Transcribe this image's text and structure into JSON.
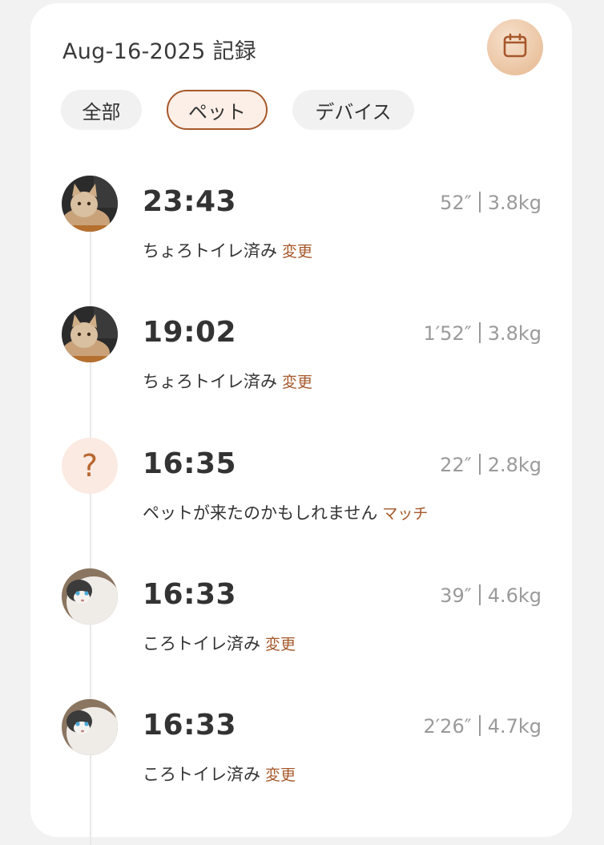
{
  "header": {
    "title": "Aug-16-2025 記録",
    "calendar_icon": "calendar-icon"
  },
  "tabs": [
    {
      "label": "全部",
      "selected": false
    },
    {
      "label": "ペット",
      "selected": true
    },
    {
      "label": "デバイス",
      "selected": false
    }
  ],
  "colors": {
    "accent": "#a6582b",
    "selected_tab_bg": "#fcefe7",
    "unknown_avatar_bg": "#fbeae2"
  },
  "entries": [
    {
      "avatar": "cat-tan-photo",
      "time": "23:43",
      "duration": "52″",
      "weight": "3.8kg",
      "status": "ちょろトイレ済み",
      "action": "変更"
    },
    {
      "avatar": "cat-tan-photo",
      "time": "19:02",
      "duration": "1′52″",
      "weight": "3.8kg",
      "status": "ちょろトイレ済み",
      "action": "変更"
    },
    {
      "avatar": "question-mark-icon",
      "avatar_text": "?",
      "time": "16:35",
      "duration": "22″",
      "weight": "2.8kg",
      "status": "ペットが来たのかもしれません",
      "action": "マッチ"
    },
    {
      "avatar": "cat-white-photo",
      "time": "16:33",
      "duration": "39″",
      "weight": "4.6kg",
      "status": "ころトイレ済み",
      "action": "変更"
    },
    {
      "avatar": "cat-white-photo",
      "time": "16:33",
      "duration": "2′26″",
      "weight": "4.7kg",
      "status": "ころトイレ済み",
      "action": "変更"
    }
  ]
}
